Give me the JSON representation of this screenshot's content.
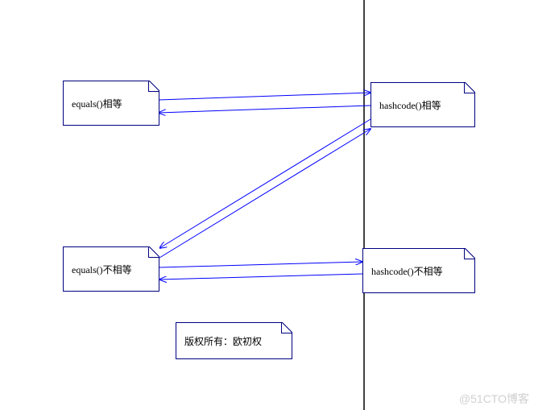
{
  "boxes": {
    "equals_equal": "equals()相等",
    "hashcode_equal": "hashcode()相等",
    "equals_not_equal": "equals()不相等",
    "hashcode_not_equal": "hashcode()不相等",
    "copyright": "版权所有：欧初权"
  },
  "watermark": "@51CTO博客",
  "colors": {
    "border": "#000080",
    "arrow": "#0000ff"
  }
}
